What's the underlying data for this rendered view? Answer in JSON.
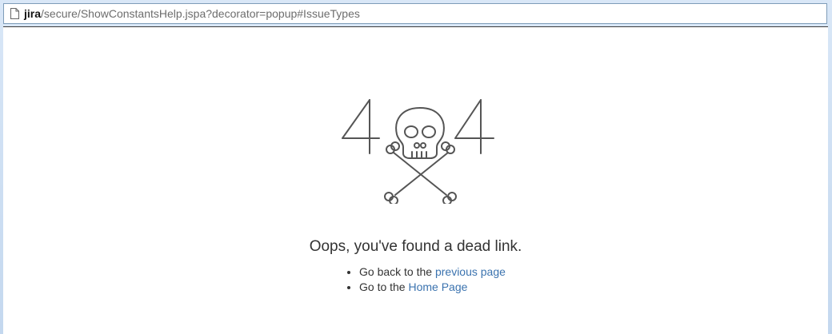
{
  "address_bar": {
    "host": "jira",
    "path": "/secure/ShowConstantsHelp.jspa?decorator=popup#IssueTypes",
    "icon": "page-icon"
  },
  "error_page": {
    "code_left": "4",
    "code_right": "4",
    "center_icon": "skull-crossbones-icon",
    "headline": "Oops, you've found a dead link.",
    "items": [
      {
        "prefix": "Go back to the ",
        "link": "previous page"
      },
      {
        "prefix": "Go to the ",
        "link": "Home Page"
      }
    ]
  },
  "colors": {
    "link": "#3b73af",
    "text": "#333333",
    "art": "#555555"
  }
}
